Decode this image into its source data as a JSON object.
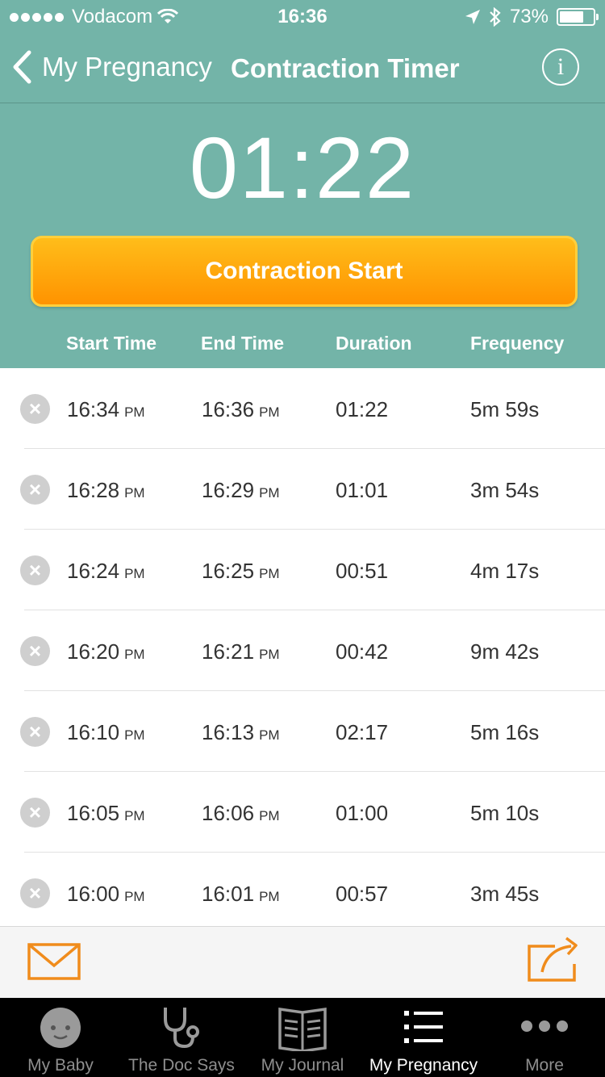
{
  "status_bar": {
    "signal_dots": 5,
    "carrier": "Vodacom",
    "time": "16:36",
    "battery": "73%",
    "battery_level": 0.73
  },
  "nav": {
    "back_label": "My Pregnancy",
    "title": "Contraction Timer",
    "info_label": "i"
  },
  "timer": {
    "elapsed": "01:22"
  },
  "start_button": {
    "label": "Contraction Start",
    "color": "#ffa000"
  },
  "columns": [
    "Start Time",
    "End Time",
    "Duration",
    "Frequency"
  ],
  "contractions": [
    {
      "start": "16:34",
      "start_ampm": "PM",
      "end": "16:36",
      "end_ampm": "PM",
      "duration": "01:22",
      "frequency": "5m 59s"
    },
    {
      "start": "16:28",
      "start_ampm": "PM",
      "end": "16:29",
      "end_ampm": "PM",
      "duration": "01:01",
      "frequency": "3m 54s"
    },
    {
      "start": "16:24",
      "start_ampm": "PM",
      "end": "16:25",
      "end_ampm": "PM",
      "duration": "00:51",
      "frequency": "4m 17s"
    },
    {
      "start": "16:20",
      "start_ampm": "PM",
      "end": "16:21",
      "end_ampm": "PM",
      "duration": "00:42",
      "frequency": "9m 42s"
    },
    {
      "start": "16:10",
      "start_ampm": "PM",
      "end": "16:13",
      "end_ampm": "PM",
      "duration": "02:17",
      "frequency": "5m 16s"
    },
    {
      "start": "16:05",
      "start_ampm": "PM",
      "end": "16:06",
      "end_ampm": "PM",
      "duration": "01:00",
      "frequency": "5m 10s"
    },
    {
      "start": "16:00",
      "start_ampm": "PM",
      "end": "16:01",
      "end_ampm": "PM",
      "duration": "00:57",
      "frequency": "3m 45s"
    }
  ],
  "actions": {
    "email_icon": "envelope-icon",
    "share_icon": "share-icon",
    "accent": "#f08c1c"
  },
  "tabs": [
    {
      "label": "My Baby",
      "icon": "baby-face-icon",
      "active": false
    },
    {
      "label": "The Doc Says",
      "icon": "stethoscope-icon",
      "active": false
    },
    {
      "label": "My Journal",
      "icon": "journal-icon",
      "active": false
    },
    {
      "label": "My Pregnancy",
      "icon": "list-icon",
      "active": true
    },
    {
      "label": "More",
      "icon": "more-dots-icon",
      "active": false
    }
  ],
  "colors": {
    "header": "#73b4a8",
    "tab_bar": "#000000",
    "active_tab": "#ffffff",
    "inactive_tab": "#8e8e8e"
  }
}
